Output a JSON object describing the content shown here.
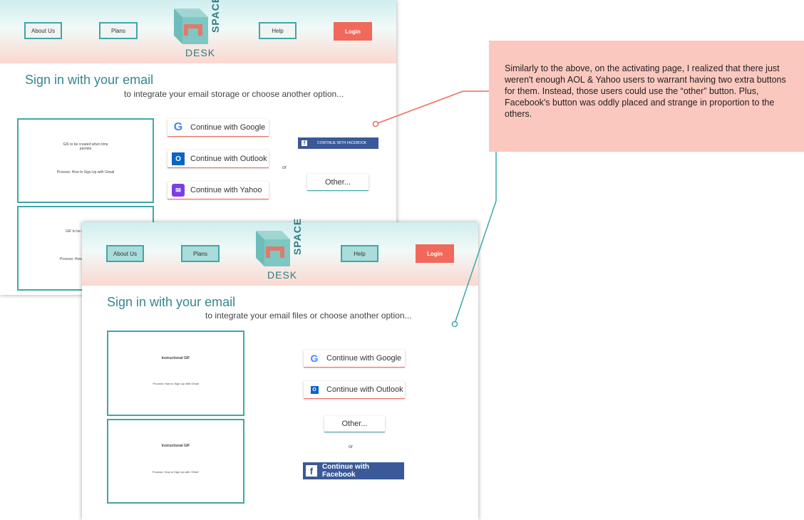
{
  "top_mockup": {
    "nav": {
      "about": "About Us",
      "plans": "Plans",
      "help": "Help",
      "login": "Login"
    },
    "logo": {
      "word1": "DESK",
      "word2": "SPACE"
    },
    "title": "Sign in with your email",
    "subtitle": "to integrate your email storage or choose another option...",
    "gif1": {
      "line1": "GIF to be created when time permits",
      "line2": "Process: How to Sign Up with Gmail"
    },
    "gif2": {
      "line1": "GIF to be c...",
      "line2": "Process: How to..."
    },
    "buttons": {
      "google": "Continue with Google",
      "outlook": "Continue with Outlook",
      "yahoo": "Continue with Yahoo",
      "facebook": "CONTINUE WITH FACEBOOK",
      "other": "Other...",
      "or": "or"
    }
  },
  "bottom_mockup": {
    "nav": {
      "about": "About Us",
      "plans": "Plans",
      "help": "Help",
      "login": "Login"
    },
    "logo": {
      "word1": "DESK",
      "word2": "SPACE"
    },
    "title": "Sign in with your email",
    "subtitle": "to integrate your email files or choose another option...",
    "gif1": {
      "title": "Instructional GIF",
      "process": "Process: How to Sign Up with Gmail"
    },
    "gif2": {
      "title": "Instructional GIF",
      "process": "Process: How to Sign Up with 'Other'"
    },
    "buttons": {
      "google": "Continue with Google",
      "outlook": "Continue with Outlook",
      "other": "Other...",
      "or": "or",
      "facebook": "Continue with Facebook"
    }
  },
  "note": "Similarly to the above, on the activating page, I realized that there just weren't enough AOL & Yahoo users to warrant having two extra buttons for them. Instead, those users could use the “other” button. Plus, Facebook's button was oddly placed and strange in proportion to the others.",
  "colors": {
    "teal": "#3fa7a7",
    "coral": "#f0695b",
    "note_bg": "#fbc8bf",
    "facebook": "#3b5998"
  }
}
